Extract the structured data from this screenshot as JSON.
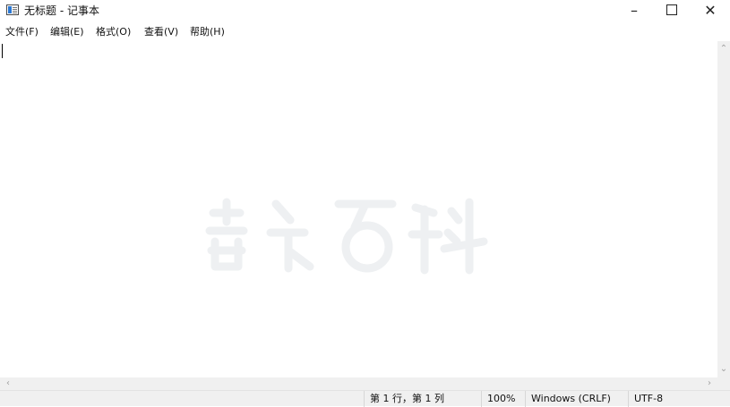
{
  "window": {
    "title": "无标题 - 记事本",
    "minimize_glyph": "–",
    "close_glyph": "✕"
  },
  "menu": [
    "文件(F)",
    "编辑(E)",
    "格式(O)",
    "查看(V)",
    "帮助(H)"
  ],
  "editor": {
    "content": ""
  },
  "scrollbar": {
    "up_arrow": "⌃",
    "down_arrow": "⌄",
    "left_arrow": "‹",
    "right_arrow": "›"
  },
  "statusbar": {
    "position": "第 1 行，第 1 列",
    "zoom": "100%",
    "line_ending": "Windows (CRLF)",
    "encoding": "UTF-8"
  },
  "colors": {
    "accent": "#2b78d4",
    "chrome_bg": "#f0f0f0",
    "editor_bg": "#ffffff"
  },
  "icons": [
    "notepad-app-icon",
    "minimize-icon",
    "maximize-icon",
    "close-icon"
  ]
}
